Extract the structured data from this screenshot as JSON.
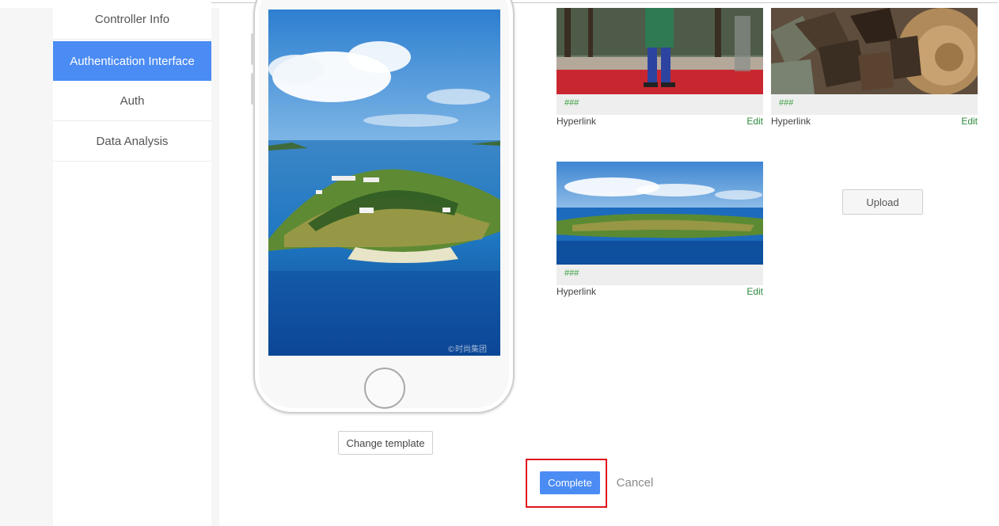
{
  "sidebar": {
    "items": [
      {
        "label": "Controller Info"
      },
      {
        "label": "Authentication Interface",
        "active": true
      },
      {
        "label": "Auth"
      },
      {
        "label": "Data Analysis"
      }
    ]
  },
  "phone": {
    "screen_watermark": "©时尚集团"
  },
  "buttons": {
    "change_template": "Change template",
    "upload": "Upload",
    "complete": "Complete",
    "cancel": "Cancel"
  },
  "cards": [
    {
      "code": "###",
      "link": "Hyperlink",
      "edit": "Edit"
    },
    {
      "code": "###",
      "link": "Hyperlink",
      "edit": "Edit"
    },
    {
      "code": "###",
      "link": "Hyperlink",
      "edit": "Edit"
    }
  ],
  "colors": {
    "accent": "#4b8bf4",
    "highlight": "#e0161b",
    "code_green": "#3aa042"
  }
}
